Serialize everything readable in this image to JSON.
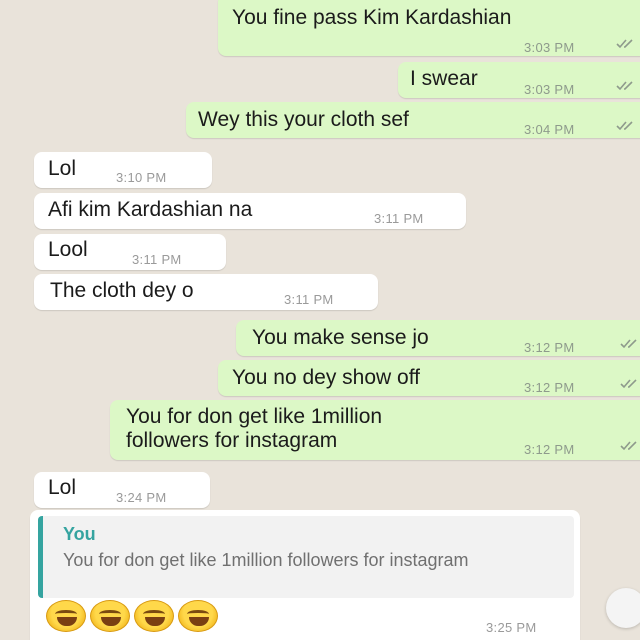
{
  "messages": [
    {
      "dir": "out",
      "text": "You fine pass Kim Kardashian",
      "time": "3:03 PM"
    },
    {
      "dir": "out",
      "text": "I swear",
      "time": "3:03 PM"
    },
    {
      "dir": "out",
      "text": "Wey this your cloth sef",
      "time": "3:04 PM"
    },
    {
      "dir": "in",
      "text": "Lol",
      "time": "3:10 PM"
    },
    {
      "dir": "in",
      "text": "Afi kim Kardashian na",
      "time": "3:11 PM"
    },
    {
      "dir": "in",
      "text": "Lool",
      "time": "3:11 PM"
    },
    {
      "dir": "in",
      "text": "The cloth dey o",
      "time": "3:11 PM"
    },
    {
      "dir": "out",
      "text": "You make sense jo",
      "time": "3:12 PM"
    },
    {
      "dir": "out",
      "text": "You no dey show off",
      "time": "3:12 PM"
    },
    {
      "dir": "out",
      "text_line1": "You for don get like 1million",
      "text_line2": "followers for instagram",
      "time": "3:12 PM"
    },
    {
      "dir": "in",
      "text": "Lol",
      "time": "3:24 PM"
    },
    {
      "dir": "in",
      "quote_author": "You",
      "quote_text": "You for don get like 1million followers for instagram",
      "emoji": "rolling-on-floor-laughing x4",
      "time": "3:25 PM"
    }
  ],
  "colors": {
    "background": "#e9e3da",
    "outgoing_bubble": "#dcf8c6",
    "incoming_bubble": "#ffffff",
    "quote_accent": "#35a4a0",
    "read_tick": "#8e9a8c"
  }
}
